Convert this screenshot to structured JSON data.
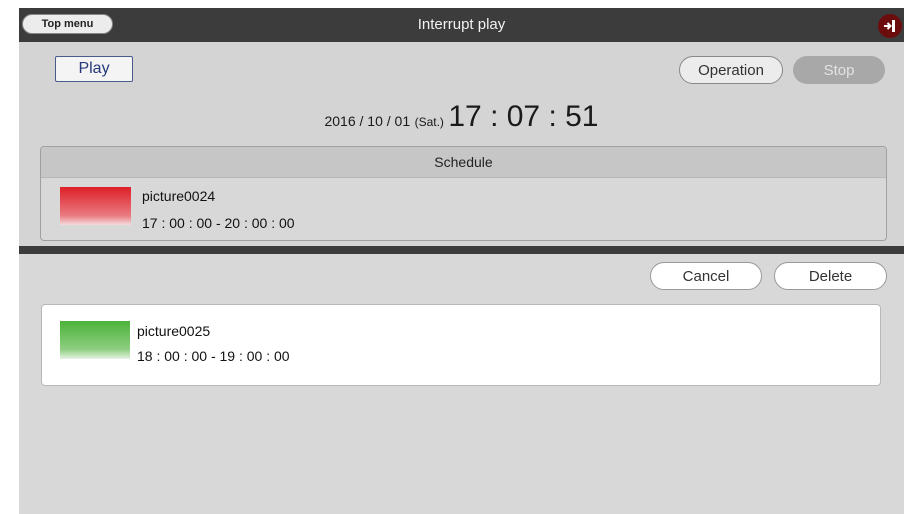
{
  "titlebar": {
    "top_menu_label": "Top menu",
    "title": "Interrupt play",
    "exit_icon": "exit-icon"
  },
  "controls": {
    "play_label": "Play",
    "operation_label": "Operation",
    "stop_label": "Stop"
  },
  "clock": {
    "date": "2016 / 10 / 01",
    "day": "(Sat.)",
    "time": "17 : 07 : 51"
  },
  "schedule": {
    "header": "Schedule",
    "item": {
      "name": "picture0024",
      "time_range": "17 : 00 : 00 - 20 : 00 : 00",
      "thumb_color": "#de1f27"
    }
  },
  "interrupt": {
    "cancel_label": "Cancel",
    "delete_label": "Delete",
    "item": {
      "name": "picture0025",
      "time_range": "18 : 00 : 00 - 19 : 00 : 00",
      "thumb_color": "#4bb23a"
    }
  }
}
